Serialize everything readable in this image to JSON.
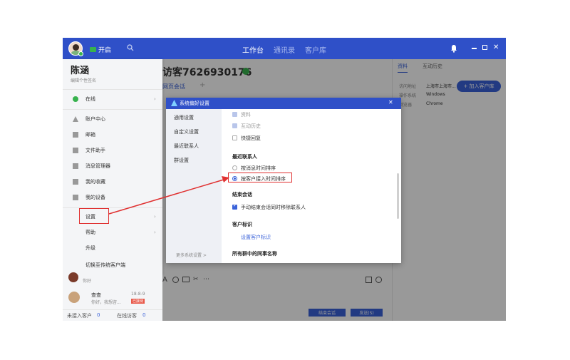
{
  "topbar": {
    "status_label": "开启",
    "tabs": [
      "工作台",
      "通讯录",
      "客户库"
    ]
  },
  "profile": {
    "name": "陈涵",
    "signature": "编辑个性签名"
  },
  "menu": {
    "status": "在线",
    "items": [
      "账户中心",
      "邮箱",
      "文件助手",
      "消息管理器",
      "我的收藏",
      "我的设备"
    ],
    "settings": "设置",
    "help": "帮助",
    "upgrade": "升级",
    "switch": "切换至传统客户端"
  },
  "chat": {
    "visitor_title": "访客7626930176",
    "tab": "网页会话",
    "add_tab": "+",
    "end_button": "结束会话",
    "send_button": "发送(S)"
  },
  "contacts": {
    "items": [
      {
        "name": "",
        "preview": "你好"
      },
      {
        "name": "查查",
        "preview": "你好，我想咨...",
        "time": "18-8-9",
        "badge": "已接待"
      }
    ]
  },
  "bottom": {
    "unreceived_label": "未接入客户",
    "unreceived_count": "0",
    "online_label": "在线访客",
    "online_count": "0"
  },
  "right_panel": {
    "tabs": [
      "资料",
      "互动历史"
    ],
    "add_button": "+ 加入客户库",
    "rows": [
      {
        "label": "访问地址",
        "value": "上海市上海市..."
      },
      {
        "label": "操作系统",
        "value": "Windows"
      },
      {
        "label": "浏览器",
        "value": "Chrome"
      }
    ]
  },
  "dialog": {
    "title": "系统偏好设置",
    "close": "✕",
    "sidebar": [
      "通用设置",
      "自定义设置",
      "最近联系人",
      "群设置"
    ],
    "more_settings": "更多系统设置 >",
    "checkbox_top": [
      {
        "label": "资料",
        "state": "disabled"
      },
      {
        "label": "互动历史",
        "state": "disabled"
      },
      {
        "label": "快捷回复",
        "state": "off"
      }
    ],
    "section_recent": "最近联系人",
    "radio_options": [
      {
        "label": "按消息时间排序",
        "selected": false
      },
      {
        "label": "按客户接入时间排序",
        "selected": true
      }
    ],
    "section_end": "结束会话",
    "end_option": "手动结束会话同时移除联系人",
    "section_customer": "客户标识",
    "customer_link": "设置客户标识",
    "section_group": "所有群中的同事名称"
  },
  "colors": {
    "brand": "#2f50c8",
    "highlight": "#e03030",
    "link": "#3a62d9"
  }
}
